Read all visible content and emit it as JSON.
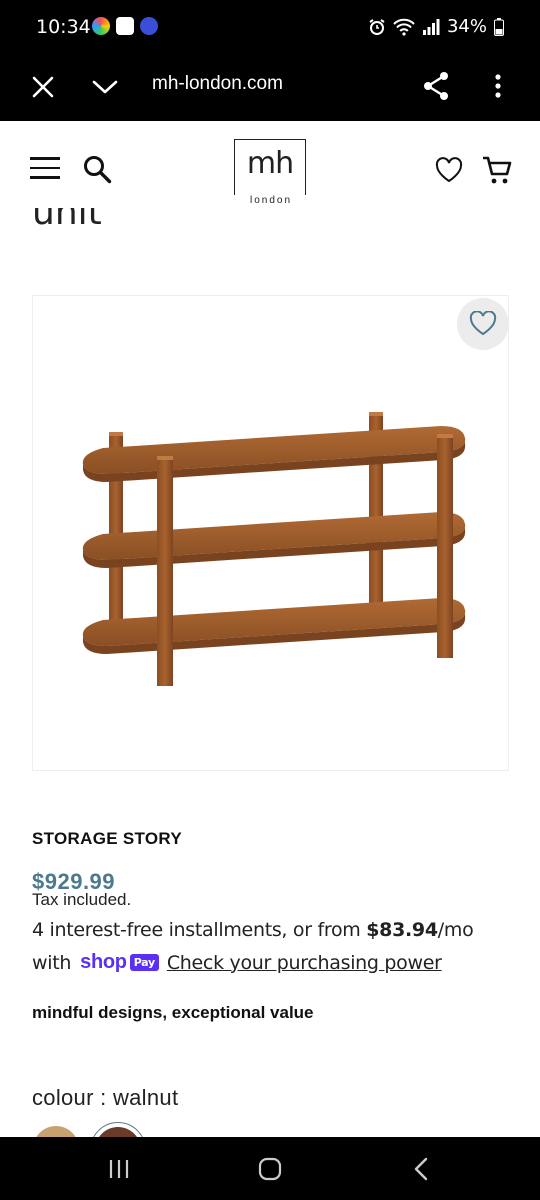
{
  "status_bar": {
    "time": "10:34",
    "battery": "34%",
    "icons_left": [
      "home-app-icon",
      "messenger-app-icon",
      "news-app-icon"
    ],
    "icons_right": [
      "alarm-icon",
      "wifi-icon",
      "signal-icon",
      "battery-icon"
    ]
  },
  "browser": {
    "url": "mh-london.com"
  },
  "header": {
    "logo_main": "mh",
    "logo_sub": "london"
  },
  "product": {
    "partial_title": "unit",
    "vendor": "STORAGE STORY",
    "price": "$929.99",
    "tax_note": "Tax included.",
    "installments_prefix": "4 interest-free installments, or from ",
    "installment_amount": "$83.94",
    "installments_suffix": "/mo",
    "with_text": "with",
    "shop_label": "shop",
    "pay_label": "Pay",
    "check_link": "Check your purchasing power",
    "tagline": "mindful designs, exceptional value",
    "colour_label": "colour : walnut"
  },
  "colors": {
    "price": "#4a7a8c",
    "shop_brand": "#5a31f4",
    "swatch_light": "#c9a070",
    "swatch_walnut": "#6a3a2a"
  }
}
